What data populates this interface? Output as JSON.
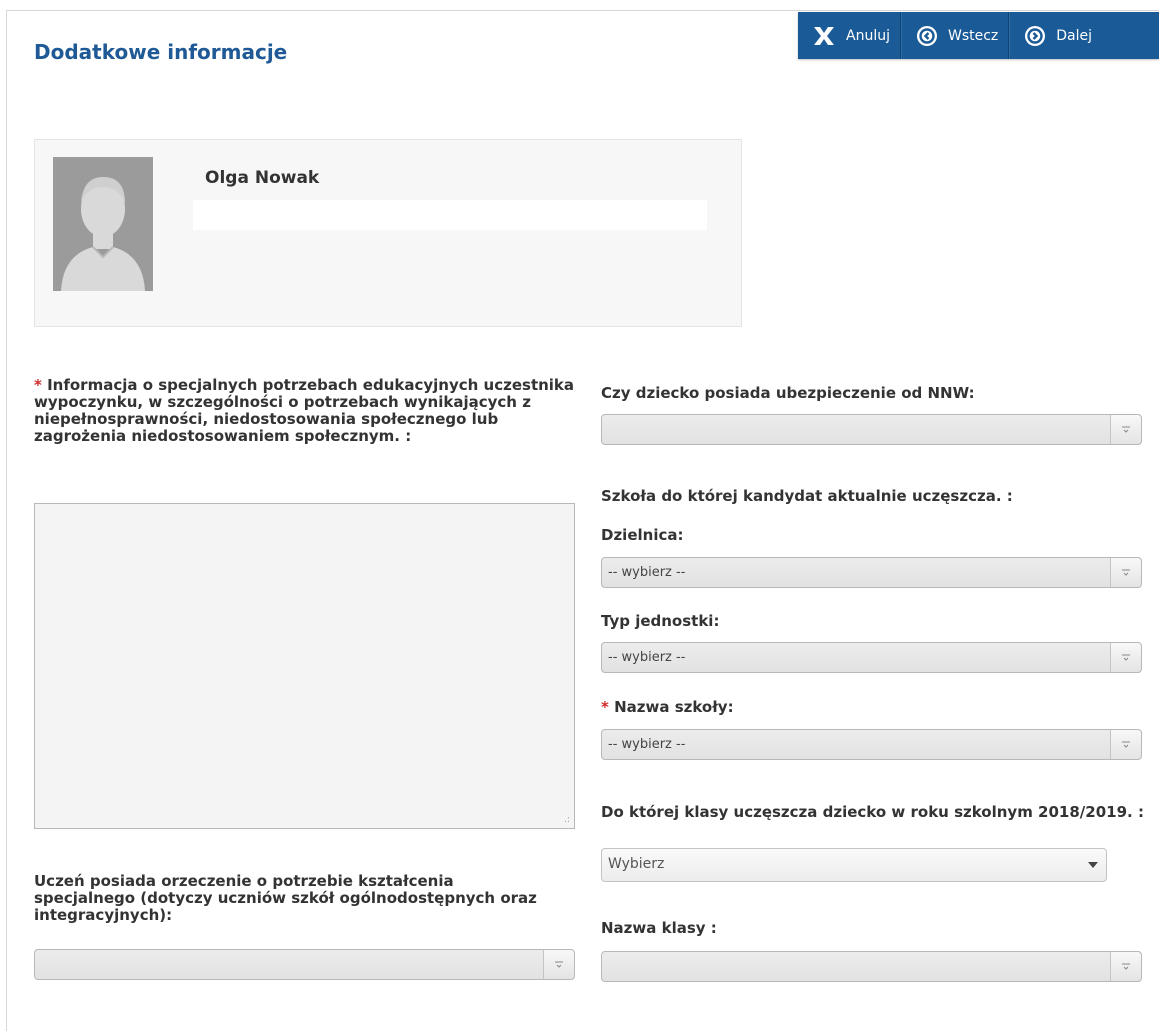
{
  "header": {
    "title": "Dodatkowe informacje"
  },
  "toolbar": {
    "cancel_label": "Anuluj",
    "back_label": "Wstecz",
    "next_label": "Dalej"
  },
  "profile": {
    "name": "Olga Nowak"
  },
  "form": {
    "required_mark": "*",
    "special_needs_label": "Informacja o specjalnych potrzebach edukacyjnych uczestnika wypoczynku, w szczególności o potrzebach wynikających z niepełnosprawności, niedostosowania społecznego lub zagrożenia niedostosowaniem społecznym. :",
    "special_needs_value": "",
    "certificate_label": "Uczeń posiada orzeczenie o potrzebie kształcenia specjalnego (dotyczy uczniów szkół ogólnodostępnych oraz integracyjnych):",
    "certificate_value": "",
    "insurance_label": "Czy dziecko posiada ubezpieczenie od NNW:",
    "insurance_value": "",
    "school_section_label": "Szkoła do której kandydat aktualnie uczęszcza. :",
    "district_label": "Dzielnica:",
    "district_value": "-- wybierz --",
    "unit_type_label": "Typ jednostki:",
    "unit_type_value": "-- wybierz --",
    "school_name_label": "Nazwa szkoły:",
    "school_name_value": "-- wybierz --",
    "grade_label": "Do której klasy uczęszcza dziecko w roku szkolnym 2018/2019. :",
    "grade_value": "Wybierz",
    "class_name_label": "Nazwa klasy :",
    "class_name_value": ""
  },
  "colors": {
    "toolbar_bg": "#1a5a96",
    "title": "#1f5a96",
    "required": "#d12a2a"
  },
  "icons": {
    "cancel": "close-icon",
    "back": "circle-chevron-left-icon",
    "next": "circle-chevron-right-icon",
    "avatar": "user-silhouette-icon",
    "select_arrow": "dropdown-arrow-icon"
  }
}
